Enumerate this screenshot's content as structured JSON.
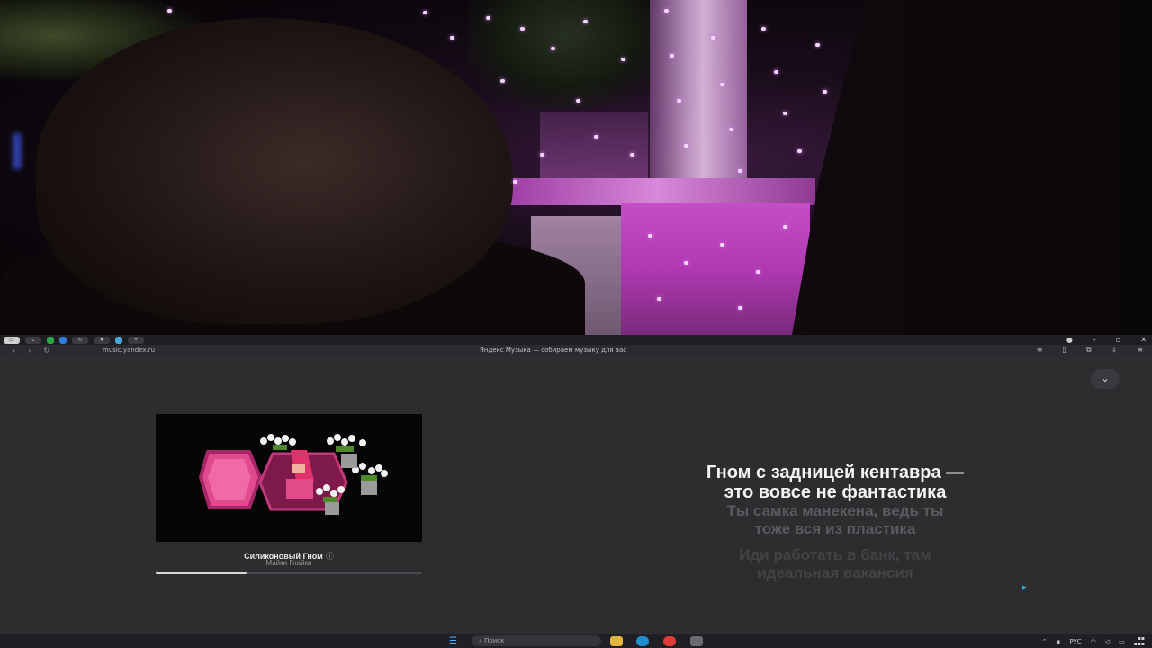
{
  "browser": {
    "url": "music.yandex.ru",
    "page_title": "Яндекс Музыка — собираем музыку для вас"
  },
  "player": {
    "collapse_icon": "chevron-down-icon",
    "track": {
      "title": "Силиконовый Гном",
      "artist": "Майки Гнайки",
      "progress": 0.34
    }
  },
  "lyrics": {
    "current": [
      "Гном с задницей кентавра —",
      "это вовсе не фантастика"
    ],
    "next": [
      "Ты самка манекена, ведь ты",
      "тоже вся из пластика"
    ],
    "later": [
      "Иди работать в банк, там",
      "идеальная вакансия"
    ]
  },
  "taskbar": {
    "search_placeholder": "Поиск",
    "lang": "РУС"
  },
  "colors": {
    "page_bg": "#2d2d30",
    "accent": "#e23aa0",
    "lyric_current": "#f4f4f4",
    "lyric_dim": "#5b5b5f"
  }
}
